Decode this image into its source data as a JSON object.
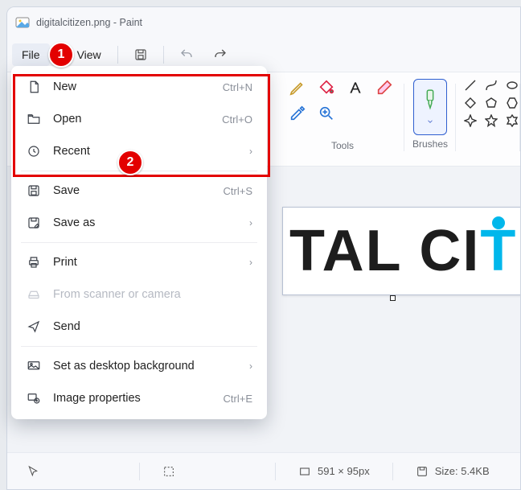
{
  "title": "digitalcitizen.png - Paint",
  "menubar": {
    "file": "File",
    "view": "View"
  },
  "ribbon": {
    "tools_label": "Tools",
    "brushes_label": "Brushes"
  },
  "file_menu": [
    {
      "icon": "file-new-icon",
      "label": "New",
      "accel": "Ctrl+N",
      "submenu": false,
      "enabled": true
    },
    {
      "icon": "folder-open-icon",
      "label": "Open",
      "accel": "Ctrl+O",
      "submenu": false,
      "enabled": true
    },
    {
      "icon": "clock-icon",
      "label": "Recent",
      "accel": "",
      "submenu": true,
      "enabled": true
    },
    {
      "sep": true
    },
    {
      "icon": "save-icon",
      "label": "Save",
      "accel": "Ctrl+S",
      "submenu": false,
      "enabled": true
    },
    {
      "icon": "save-as-icon",
      "label": "Save as",
      "accel": "",
      "submenu": true,
      "enabled": true
    },
    {
      "sep": true
    },
    {
      "icon": "print-icon",
      "label": "Print",
      "accel": "",
      "submenu": true,
      "enabled": true
    },
    {
      "icon": "scanner-icon",
      "label": "From scanner or camera",
      "accel": "",
      "submenu": false,
      "enabled": false
    },
    {
      "icon": "send-icon",
      "label": "Send",
      "accel": "",
      "submenu": false,
      "enabled": true
    },
    {
      "sep": true
    },
    {
      "icon": "desktop-bg-icon",
      "label": "Set as desktop background",
      "accel": "",
      "submenu": true,
      "enabled": true
    },
    {
      "icon": "properties-icon",
      "label": "Image properties",
      "accel": "Ctrl+E",
      "submenu": false,
      "enabled": true
    }
  ],
  "canvas_text": {
    "part1": "TAL CI",
    "part2": "T"
  },
  "status": {
    "dimensions": "591 × 95px",
    "size_label": "Size: 5.4KB"
  },
  "callouts": {
    "badge1": "1",
    "badge2": "2"
  }
}
